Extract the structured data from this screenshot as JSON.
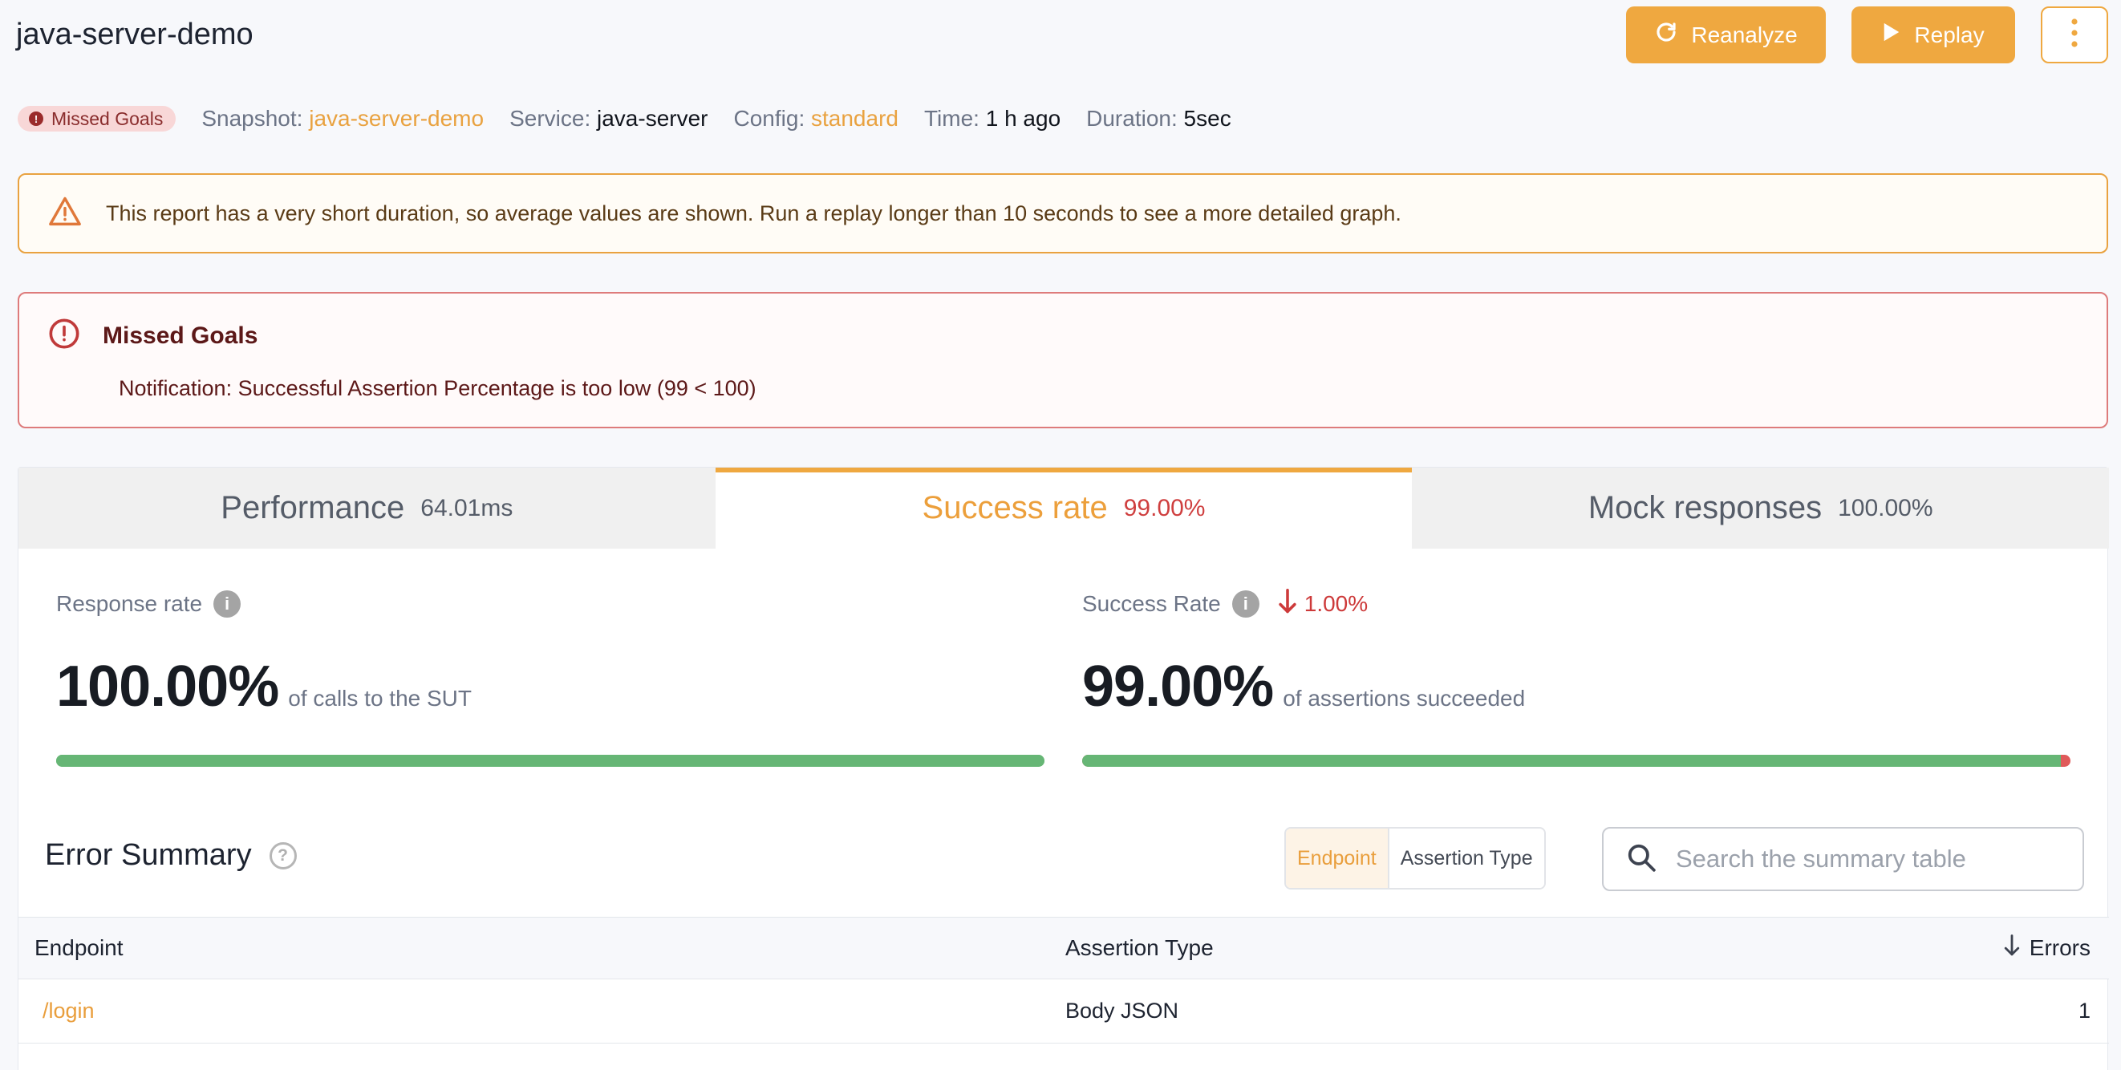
{
  "header": {
    "title": "java-server-demo",
    "reanalyze_label": "Reanalyze",
    "replay_label": "Replay"
  },
  "meta": {
    "badge": "Missed Goals",
    "snapshot_key": "Snapshot:",
    "snapshot_value": "java-server-demo",
    "service_key": "Service:",
    "service_value": "java-server",
    "config_key": "Config:",
    "config_value": "standard",
    "time_key": "Time:",
    "time_value": "1 h ago",
    "duration_key": "Duration:",
    "duration_value": "5sec"
  },
  "warning": {
    "text": "This report has a very short duration, so average values are shown. Run a replay longer than 10 seconds to see a more detailed graph."
  },
  "error_banner": {
    "title": "Missed Goals",
    "text": "Notification: Successful Assertion Percentage is too low (99 < 100)"
  },
  "tabs": [
    {
      "label": "Performance",
      "value": "64.01ms"
    },
    {
      "label": "Success rate",
      "value": "99.00%"
    },
    {
      "label": "Mock responses",
      "value": "100.00%"
    }
  ],
  "metrics": {
    "response": {
      "label": "Response rate",
      "value": "100.00%",
      "caption": "of calls to the SUT",
      "fill_fraction": 1.0
    },
    "success": {
      "label": "Success Rate",
      "delta": "1.00%",
      "value": "99.00%",
      "caption": "of assertions succeeded",
      "fill_fraction": 0.99
    }
  },
  "error_summary": {
    "title": "Error Summary",
    "toggle": [
      "Endpoint",
      "Assertion Type"
    ],
    "search_placeholder": "Search the summary table",
    "columns": [
      "Endpoint",
      "Assertion Type",
      "Errors"
    ],
    "rows": [
      {
        "endpoint": "/login",
        "assertion_type": "Body JSON",
        "errors": "1"
      }
    ]
  },
  "colors": {
    "accent": "#efa840",
    "danger": "#cf3f3f",
    "success_bar": "#66b675"
  }
}
